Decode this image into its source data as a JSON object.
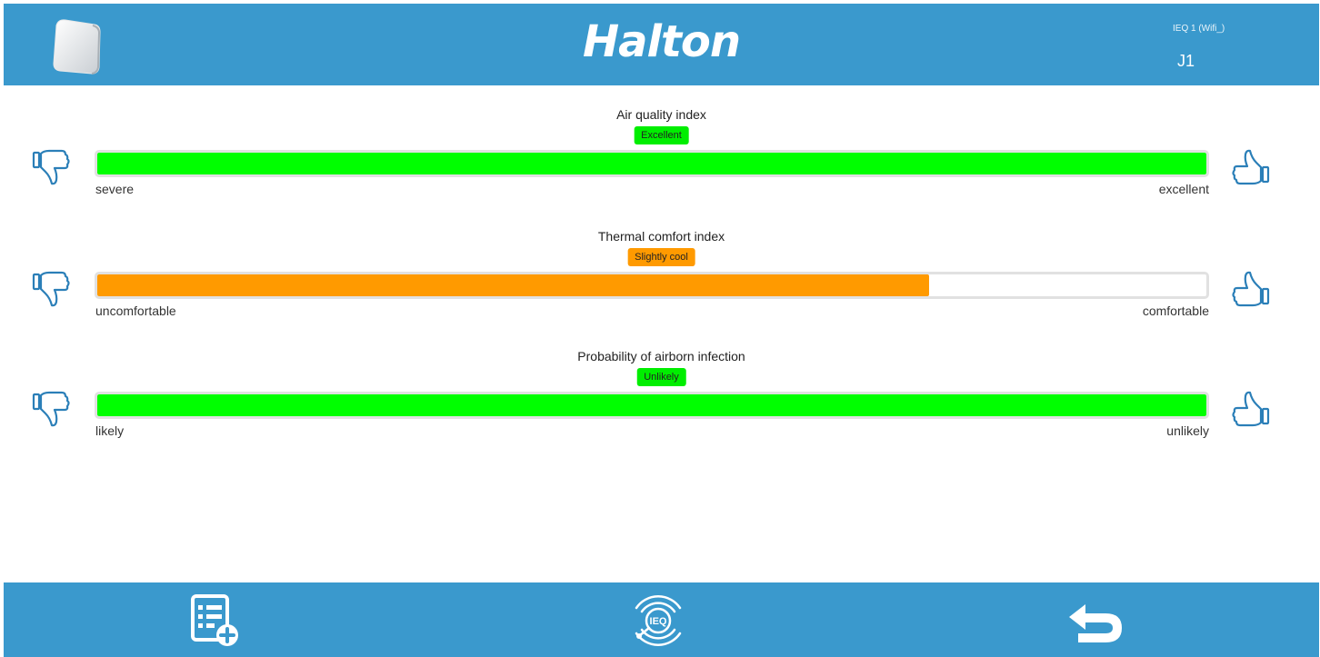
{
  "header": {
    "brand": "Halton",
    "device_subtitle": "IEQ 1 (Wifi_)",
    "device_id": "J1"
  },
  "meters": [
    {
      "title": "Air quality index",
      "status": "Excellent",
      "status_color": "#00ee00",
      "fill_fraction": 1.0,
      "fill_color": "#00ff00",
      "left_label": "severe",
      "right_label": "excellent"
    },
    {
      "title": "Thermal comfort index",
      "status": "Slightly cool",
      "status_color": "#ff9a00",
      "fill_fraction": 0.75,
      "fill_color": "#ff9a00",
      "left_label": "uncomfortable",
      "right_label": "comfortable"
    },
    {
      "title": "Probability of airborn infection",
      "status": "Unlikely",
      "status_color": "#00ee00",
      "fill_fraction": 1.0,
      "fill_color": "#00ff00",
      "left_label": "likely",
      "right_label": "unlikely"
    }
  ],
  "footer": {
    "buttons": [
      {
        "name": "add-list-icon"
      },
      {
        "name": "ieq-sensor-icon",
        "text": "IEQ"
      },
      {
        "name": "back-arrow-icon"
      }
    ]
  },
  "colors": {
    "bar_blue": "#3a99cd",
    "icon_blue": "#2b7fb8",
    "track_border": "#e1e1e1"
  }
}
